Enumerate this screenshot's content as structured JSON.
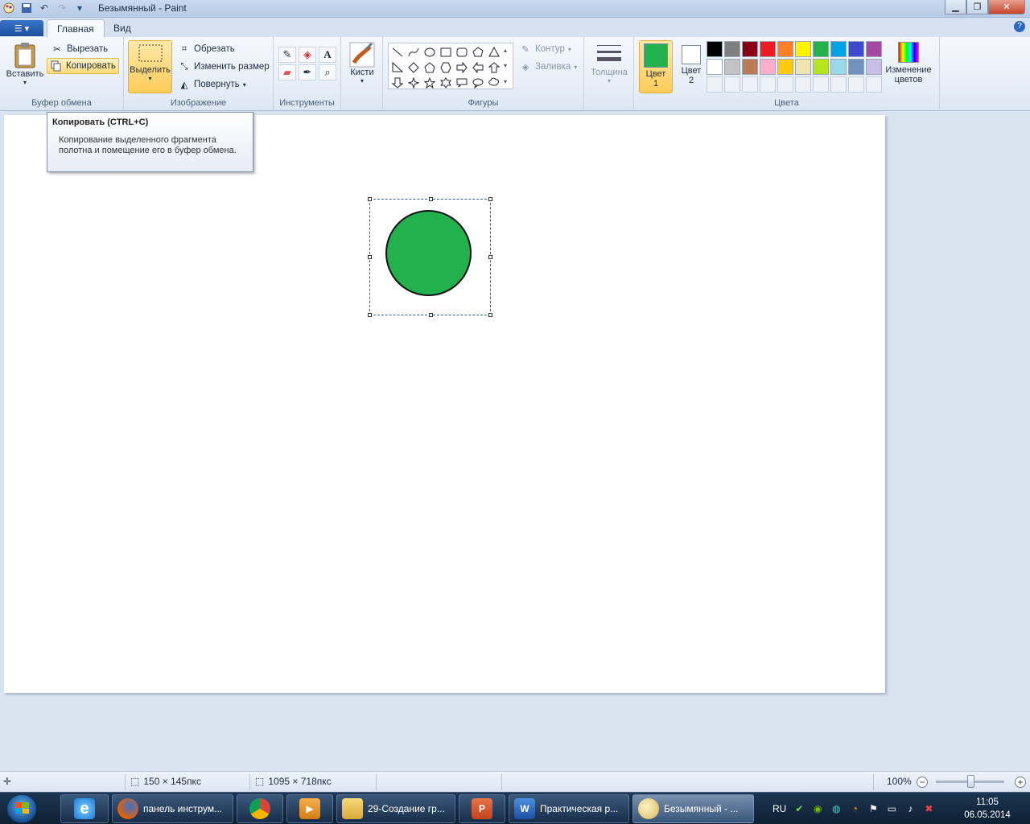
{
  "window": {
    "title": "Безымянный - Paint"
  },
  "tabs": {
    "home": "Главная",
    "view": "Вид"
  },
  "clipboard": {
    "paste": "Вставить",
    "cut": "Вырезать",
    "copy": "Копировать",
    "label": "Буфер обмена"
  },
  "image": {
    "select": "Выделить",
    "crop": "Обрезать",
    "resize": "Изменить размер",
    "rotate": "Повернуть",
    "label": "Изображение"
  },
  "tools": {
    "label": "Инструменты",
    "text_tool": "A"
  },
  "brushes": {
    "label": "Кисти"
  },
  "shapes": {
    "outline": "Контур",
    "fill": "Заливка",
    "label": "Фигуры"
  },
  "size": {
    "label": "Толщина"
  },
  "colors": {
    "color1_label": "Цвет 1",
    "color2_label": "Цвет 2",
    "edit_colors": "Изменение цветов",
    "label": "Цвета",
    "color1": "#22b14c",
    "color2": "#ffffff",
    "palette_row1": [
      "#000000",
      "#7f7f7f",
      "#880015",
      "#ed1c24",
      "#ff7f27",
      "#fff200",
      "#22b14c",
      "#00a2e8",
      "#3f48cc",
      "#a349a4"
    ],
    "palette_row2": [
      "#ffffff",
      "#c3c3c3",
      "#b97a57",
      "#ffaec9",
      "#ffc90e",
      "#efe4b0",
      "#b5e61d",
      "#99d9ea",
      "#7092be",
      "#c8bfe7"
    ]
  },
  "tooltip": {
    "title": "Копировать (CTRL+C)",
    "body": "Копирование выделенного фрагмента полотна и помещение его в буфер обмена."
  },
  "status": {
    "selection_size": "150 × 145пкс",
    "canvas_size": "1095 × 718пкс",
    "zoom": "100%"
  },
  "taskbar": {
    "items": [
      {
        "label": "панель инструм..."
      },
      {
        "label": "29-Создание гр..."
      },
      {
        "label": "Практическая р..."
      },
      {
        "label": "Безымянный - ..."
      }
    ],
    "lang": "RU",
    "time": "11:05",
    "date": "06.05.2014"
  }
}
